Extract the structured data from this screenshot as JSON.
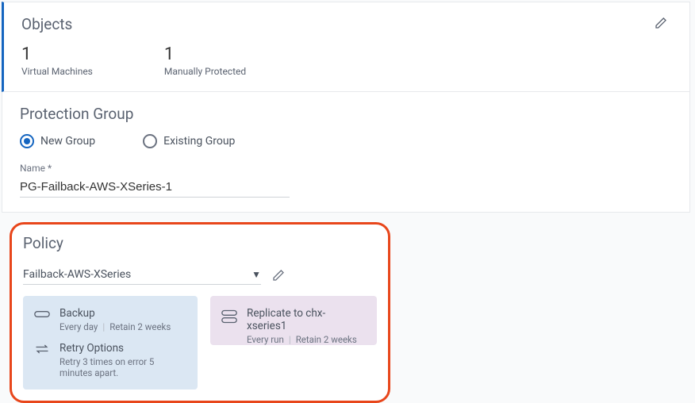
{
  "objects": {
    "title": "Objects",
    "stats": [
      {
        "value": "1",
        "label": "Virtual Machines"
      },
      {
        "value": "1",
        "label": "Manually Protected"
      }
    ]
  },
  "group": {
    "title": "Protection Group",
    "radios": {
      "new": "New Group",
      "existing": "Existing Group"
    },
    "name_label": "Name *",
    "name_value": "PG-Failback-AWS-XSeries-1"
  },
  "policy": {
    "title": "Policy",
    "selected": "Failback-AWS-XSeries",
    "backup": {
      "title": "Backup",
      "freq": "Every day",
      "retain": "Retain 2 weeks"
    },
    "retry": {
      "title": "Retry Options",
      "detail": "Retry 3 times on error 5 minutes apart."
    },
    "replicate": {
      "title": "Replicate to chx-xseries1",
      "freq": "Every run",
      "retain": "Retain 2 weeks"
    }
  }
}
